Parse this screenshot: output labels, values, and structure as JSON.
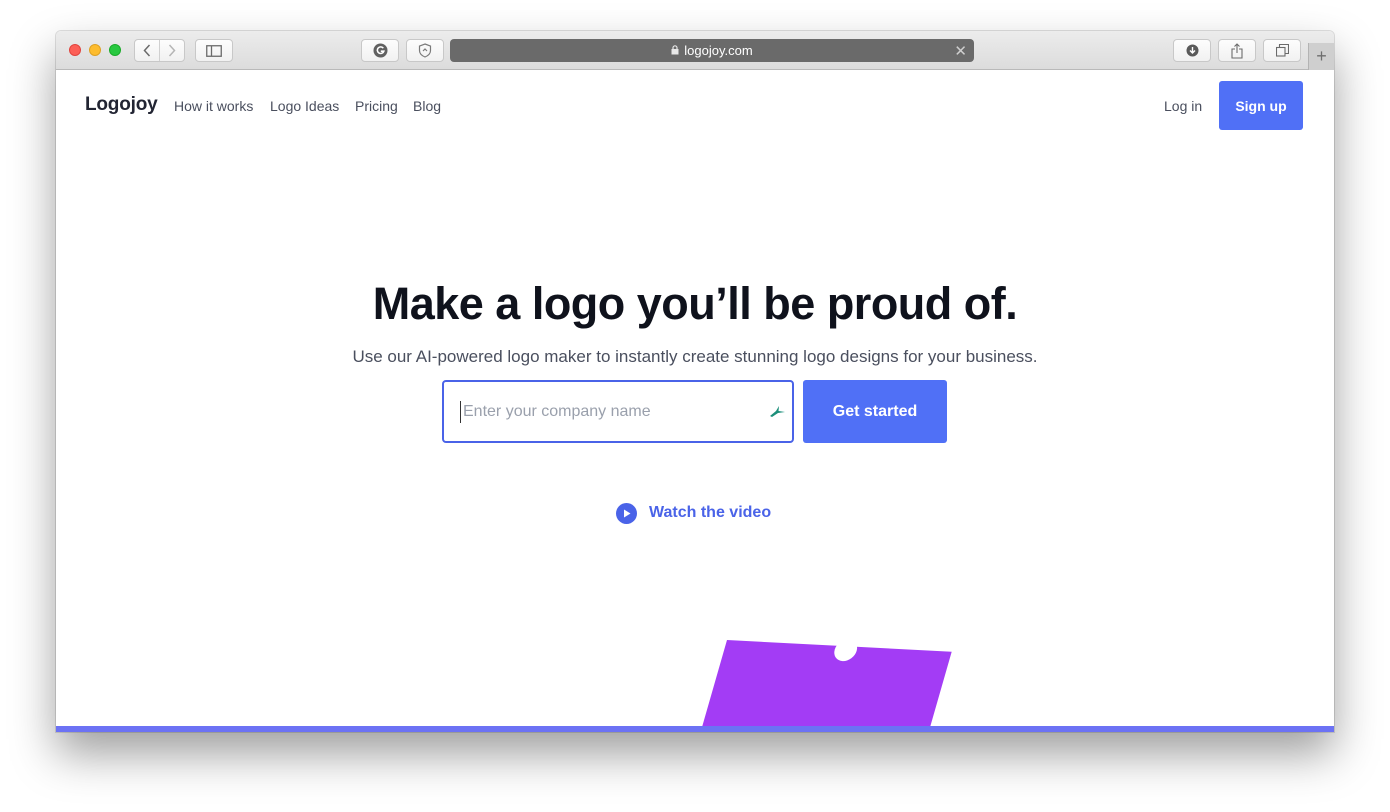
{
  "browser": {
    "url": "logojoy.com",
    "icons": {
      "back": "chevron-left-icon",
      "forward": "chevron-right-icon",
      "sidebar": "sidebar-icon",
      "extension_1": "grammarly-icon",
      "extension_2": "shield-icon",
      "lock": "lock-icon",
      "clear": "close-icon",
      "download": "download-icon",
      "share": "share-icon",
      "tabs": "tabs-overview-icon",
      "new_tab": "+"
    }
  },
  "header": {
    "brand": "Logojoy",
    "nav": [
      {
        "label": "How it works"
      },
      {
        "label": "Logo Ideas"
      },
      {
        "label": "Pricing"
      },
      {
        "label": "Blog"
      }
    ],
    "login_label": "Log in",
    "signup_label": "Sign up"
  },
  "hero": {
    "title": "Make a logo you’ll be proud of.",
    "subtitle": "Use our AI-powered logo maker to instantly create stunning logo designs for your business.",
    "input_placeholder": "Enter your company name",
    "input_value": "",
    "cta_label": "Get started",
    "video_label": "Watch the video"
  },
  "colors": {
    "accent": "#5070f6",
    "link": "#4a63e8",
    "card": "#a33cf5",
    "bottom_bar": "#6c72f4"
  }
}
